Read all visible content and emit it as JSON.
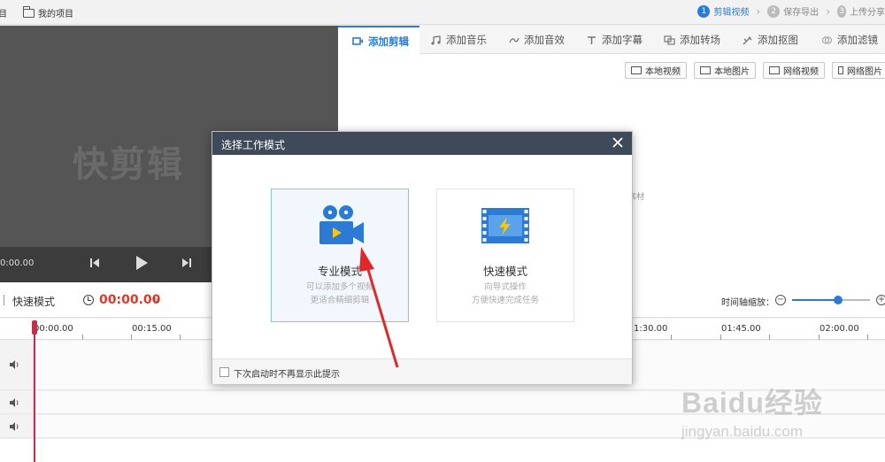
{
  "topbar": {
    "left_partial": "目",
    "my_projects": "我的项目",
    "steps": [
      {
        "num": "1",
        "label": "剪辑视频",
        "active": true
      },
      {
        "num": "2",
        "label": "保存导出",
        "active": false
      },
      {
        "num": "3",
        "label": "上传分享",
        "active": false
      }
    ]
  },
  "preview": {
    "watermark": "快剪辑",
    "time": "0:00.00"
  },
  "panel": {
    "tabs": [
      {
        "label": "添加剪辑",
        "icon": "video-camera-icon",
        "active": true
      },
      {
        "label": "添加音乐",
        "icon": "music-note-icon",
        "active": false
      },
      {
        "label": "添加音效",
        "icon": "sound-effect-icon",
        "active": false
      },
      {
        "label": "添加字幕",
        "icon": "text-t-icon",
        "active": false
      },
      {
        "label": "添加转场",
        "icon": "transition-icon",
        "active": false
      },
      {
        "label": "添加抠图",
        "icon": "cutout-icon",
        "active": false
      },
      {
        "label": "添加滤镜",
        "icon": "filter-icon",
        "active": false
      }
    ],
    "source_buttons": [
      "本地视频",
      "本地图片",
      "网络视频",
      "网络图片"
    ],
    "faint_text": "素材"
  },
  "timeline": {
    "mode_label": "快速模式",
    "current_time": "00:00.00",
    "zoom_label": "时间轴缩放：",
    "ruler": [
      "00:00.00",
      "00:15.00",
      "1:30.00",
      "01:45.00",
      "02:00.00"
    ]
  },
  "dialog": {
    "title": "选择工作模式",
    "modes": [
      {
        "name": "专业模式",
        "desc1": "可以添加多个视频",
        "desc2": "更适合精细剪辑"
      },
      {
        "name": "快速模式",
        "desc1": "向导式操作",
        "desc2": "方便快速完成任务"
      }
    ],
    "checkbox_label": "下次启动时不再显示此提示"
  },
  "watermark": {
    "brand": "Baidu经验",
    "url": "jingyan.baidu.com"
  },
  "colors": {
    "accent": "#2b7ad6",
    "time_red": "#e0362c",
    "dialog_header": "#3e4a59",
    "arrow": "#e02828"
  }
}
